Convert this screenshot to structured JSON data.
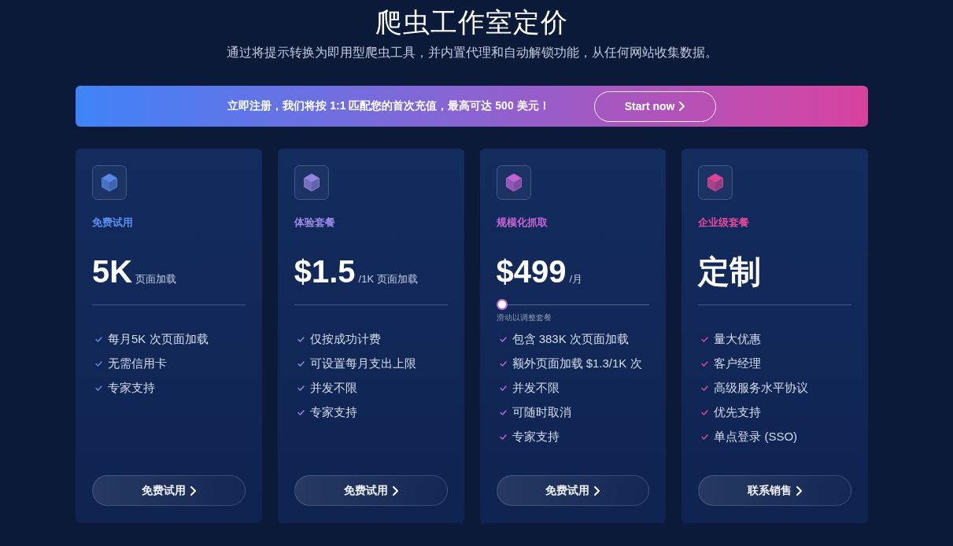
{
  "title": "爬虫工作室定价",
  "subtitle": "通过将提示转换为即用型爬虫工具，并内置代理和自动解锁功能，从任何网站收集数据。",
  "banner": {
    "text": "立即注册，我们将按 1:1 匹配您的首次充值，最高可达 500 美元！",
    "button": "Start now"
  },
  "plans": [
    {
      "kind": "standard",
      "name": "免费试用",
      "color": "#5b8def",
      "price": "5K",
      "unit": "页面加载",
      "features": [
        "每月5K 次页面加载",
        "无需信用卡",
        "专家支持"
      ],
      "button": "免费试用"
    },
    {
      "kind": "standard",
      "name": "体验套餐",
      "color": "#9a8ae6",
      "price": "$1.5",
      "unit": "/1K 页面加载",
      "features": [
        "仅按成功计费",
        "可设置每月支出上限",
        "并发不限",
        "专家支持"
      ],
      "button": "免费试用"
    },
    {
      "kind": "slider",
      "name": "规模化抓取",
      "color": "#c866d6",
      "price": "$499",
      "unit": "/月",
      "slider": {
        "level": 0,
        "hint": "滑动以调整套餐"
      },
      "features": [
        "包含 383K 次页面加载",
        "额外页面加载 $1.3/1K 次",
        "并发不限",
        "可随时取消",
        "专家支持"
      ],
      "button": "免费试用"
    },
    {
      "kind": "standard",
      "name": "企业级套餐",
      "color": "#e8489a",
      "price": "定制",
      "features": [
        "量大优惠",
        "客户经理",
        "高级服务水平协议",
        "优先支持",
        "单点登录 (SSO)"
      ],
      "button": "联系销售"
    }
  ]
}
